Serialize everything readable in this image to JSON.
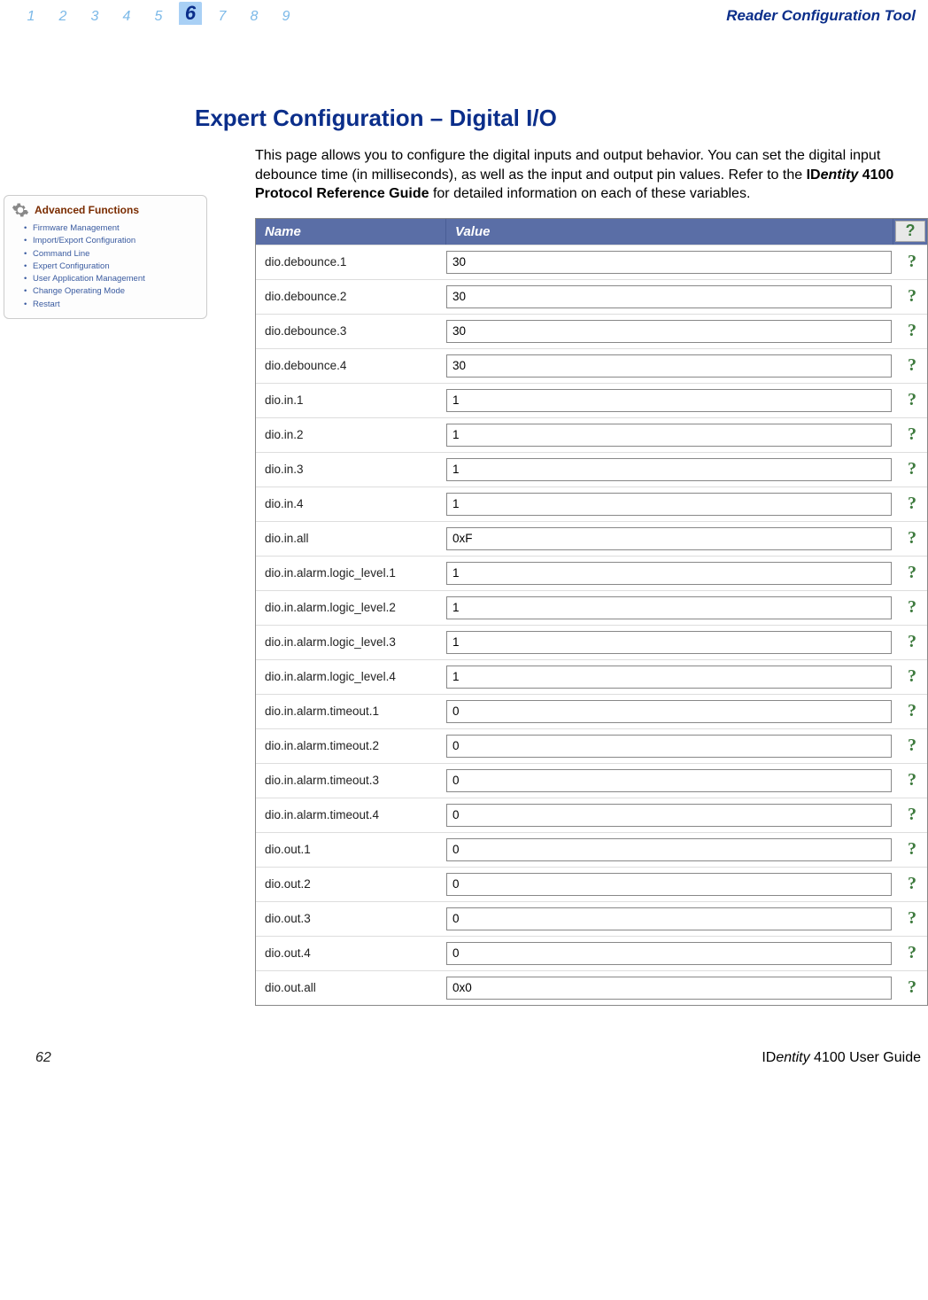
{
  "header": {
    "tabs": [
      "1",
      "2",
      "3",
      "4",
      "5",
      "6",
      "7",
      "8",
      "9"
    ],
    "active_index": 5,
    "title": "Reader Configuration Tool"
  },
  "sidebar": {
    "title": "Advanced Functions",
    "items": [
      "Firmware Management",
      "Import/Export Configuration",
      "Command Line",
      "Expert Configuration",
      "User Application Management",
      "Change Operating Mode",
      "Restart"
    ]
  },
  "section": {
    "title": "Expert Configuration – Digital I/O",
    "body_pre": "This page allows you to configure the digital inputs and output behavior. You can set the digital input debounce time (in milliseconds), as well as the input and output pin values. Refer to the ",
    "body_ref_prefix": "ID",
    "body_ref_italic": "entity",
    "body_ref_suffix": " 4100 Protocol Reference Guide",
    "body_post": " for detailed information on each of these variables."
  },
  "table": {
    "header_name": "Name",
    "header_value": "Value",
    "header_help": "?",
    "rows": [
      {
        "name": "dio.debounce.1",
        "value": "30"
      },
      {
        "name": "dio.debounce.2",
        "value": "30"
      },
      {
        "name": "dio.debounce.3",
        "value": "30"
      },
      {
        "name": "dio.debounce.4",
        "value": "30"
      },
      {
        "name": "dio.in.1",
        "value": "1"
      },
      {
        "name": "dio.in.2",
        "value": "1"
      },
      {
        "name": "dio.in.3",
        "value": "1"
      },
      {
        "name": "dio.in.4",
        "value": "1"
      },
      {
        "name": "dio.in.all",
        "value": "0xF"
      },
      {
        "name": "dio.in.alarm.logic_level.1",
        "value": "1"
      },
      {
        "name": "dio.in.alarm.logic_level.2",
        "value": "1"
      },
      {
        "name": "dio.in.alarm.logic_level.3",
        "value": "1"
      },
      {
        "name": "dio.in.alarm.logic_level.4",
        "value": "1"
      },
      {
        "name": "dio.in.alarm.timeout.1",
        "value": "0"
      },
      {
        "name": "dio.in.alarm.timeout.2",
        "value": "0"
      },
      {
        "name": "dio.in.alarm.timeout.3",
        "value": "0"
      },
      {
        "name": "dio.in.alarm.timeout.4",
        "value": "0"
      },
      {
        "name": "dio.out.1",
        "value": "0"
      },
      {
        "name": "dio.out.2",
        "value": "0"
      },
      {
        "name": "dio.out.3",
        "value": "0"
      },
      {
        "name": "dio.out.4",
        "value": "0"
      },
      {
        "name": "dio.out.all",
        "value": "0x0"
      }
    ]
  },
  "footer": {
    "page": "62",
    "title_prefix": "ID",
    "title_italic": "entity",
    "title_suffix": " 4100 User Guide"
  }
}
